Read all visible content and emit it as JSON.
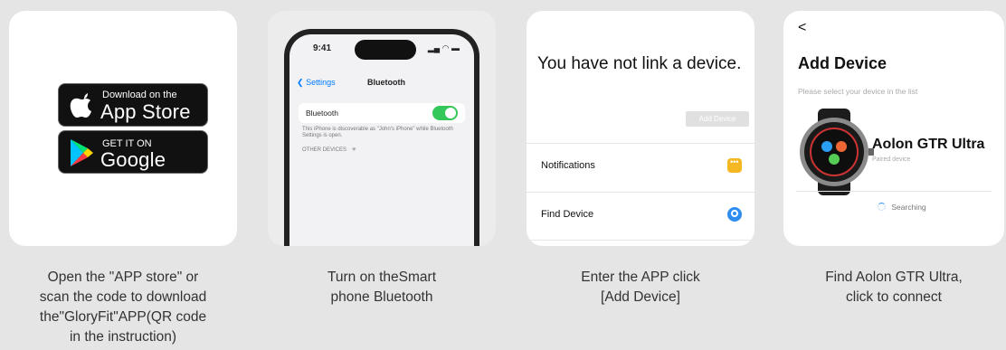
{
  "colors": {
    "background": "#e5e5e5",
    "card": "#ffffff",
    "toggle_on": "#34c759",
    "ios_blue": "#007aff"
  },
  "step1": {
    "appstore_small": "Download on the",
    "appstore_large": "App Store",
    "appstore_icon": "apple-icon",
    "googleplay_small": "GET IT ON",
    "googleplay_large": "Google Play",
    "googleplay_icon": "play-icon",
    "caption_lines": [
      "Open the \"APP store\" or",
      "scan the code to download",
      "the\"GloryFit\"APP(QR code",
      "in the instruction)"
    ]
  },
  "step2": {
    "time": "9:41",
    "back_label": "Settings",
    "title": "Bluetooth",
    "row_label": "Bluetooth",
    "note": "This iPhone is discoverable as \"John's iPhone\" while Bluetooth Settings is open.",
    "other_devices": "OTHER DEVICES",
    "caption_lines": [
      "Turn on theSmart",
      "phone Bluetooth"
    ]
  },
  "step3": {
    "heading": "You have not link a device.",
    "add_button": "Add Device",
    "rows": [
      {
        "label": "Notifications",
        "icon": "message-icon",
        "color": "#f5b823"
      },
      {
        "label": "Find Device",
        "icon": "locate-icon",
        "color": "#2f8cf0"
      }
    ],
    "caption_lines": [
      "Enter the APP click",
      "[Add Device]"
    ]
  },
  "step4": {
    "back": "<",
    "title": "Add Device",
    "subtitle": "Please select your device in the list",
    "device_name": "Aolon GTR Ultra",
    "device_status": "Paired device",
    "searching": "Searching",
    "caption_lines": [
      "Find Aolon GTR Ultra,",
      "click to connect"
    ]
  }
}
